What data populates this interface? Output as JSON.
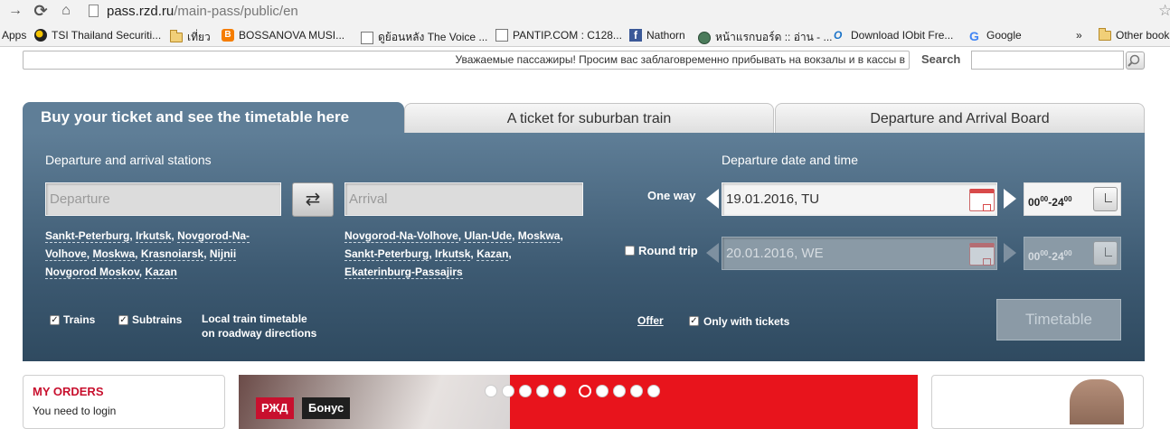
{
  "browser": {
    "url_host": "pass.rzd.ru",
    "url_path": "/main-pass/public/en",
    "bookmarks": [
      {
        "label": "Apps",
        "icon": "apps-icon"
      },
      {
        "label": "TSI Thailand Securiti...",
        "icon": "tsi-icon"
      },
      {
        "label": "เที่ยว",
        "icon": "folder-icon"
      },
      {
        "label": "BOSSANOVA MUSI...",
        "icon": "blogger-icon"
      },
      {
        "label": "ดูย้อนหลัง The Voice ...",
        "icon": "page-icon"
      },
      {
        "label": "PANTIP.COM : C128...",
        "icon": "page-icon"
      },
      {
        "label": "Nathorn",
        "icon": "facebook-icon"
      },
      {
        "label": "หน้าแรกบอร์ด :: อ่าน - ...",
        "icon": "globe-icon"
      },
      {
        "label": "Download IObit Fre...",
        "icon": "iobit-icon"
      },
      {
        "label": "Google",
        "icon": "google-icon"
      },
      {
        "label": "»",
        "icon": ""
      },
      {
        "label": "Other book",
        "icon": "folder-icon"
      }
    ]
  },
  "header": {
    "ticker": "Уважаемые пассажиры! Просим вас заблаговременно прибывать на вокзалы и в кассы в",
    "search_label": "Search"
  },
  "tabs": {
    "active": "Buy your ticket and see the timetable here",
    "suburban": "A ticket for suburban train",
    "board": "Departure and Arrival Board"
  },
  "form": {
    "stations_heading": "Departure and arrival stations",
    "departure_placeholder": "Departure",
    "arrival_placeholder": "Arrival",
    "departure_links": [
      "Sankt-Peterburg",
      "Irkutsk",
      "Novgorod-Na-Volhove",
      "Moskwa",
      "Krasnoiarsk",
      "Nijnii Novgorod Moskov",
      "Kazan"
    ],
    "arrival_links": [
      "Novgorod-Na-Volhove",
      "Ulan-Ude",
      "Moskwa",
      "Sankt-Peterburg",
      "Irkutsk",
      "Kazan",
      "Ekaterinburg-Passajirs"
    ],
    "date_heading": "Departure date and time",
    "one_way_label": "One way",
    "one_way_date": "19.01.2016, TU",
    "round_trip_label": "Round trip",
    "round_trip_date": "20.01.2016, WE",
    "time_from": "00",
    "time_sup_from": "00",
    "time_to": "24",
    "time_sup_to": "00",
    "trains_label": "Trains",
    "subtrains_label": "Subtrains",
    "local_timetable_line1": "Local train timetable",
    "local_timetable_line2": "on roadway directions",
    "offer_label": "Offer",
    "only_tickets_label": "Only with tickets",
    "timetable_button": "Timetable"
  },
  "bottom": {
    "orders_title": "MY ORDERS",
    "orders_text": "You need to login",
    "banner_logo": "РЖД",
    "banner_bonus": "Бонус"
  },
  "colors": {
    "panel_top": "#5f7e97",
    "panel_bottom": "#2f4a60",
    "accent_red": "#c8102e",
    "banner_red": "#e8141c"
  }
}
